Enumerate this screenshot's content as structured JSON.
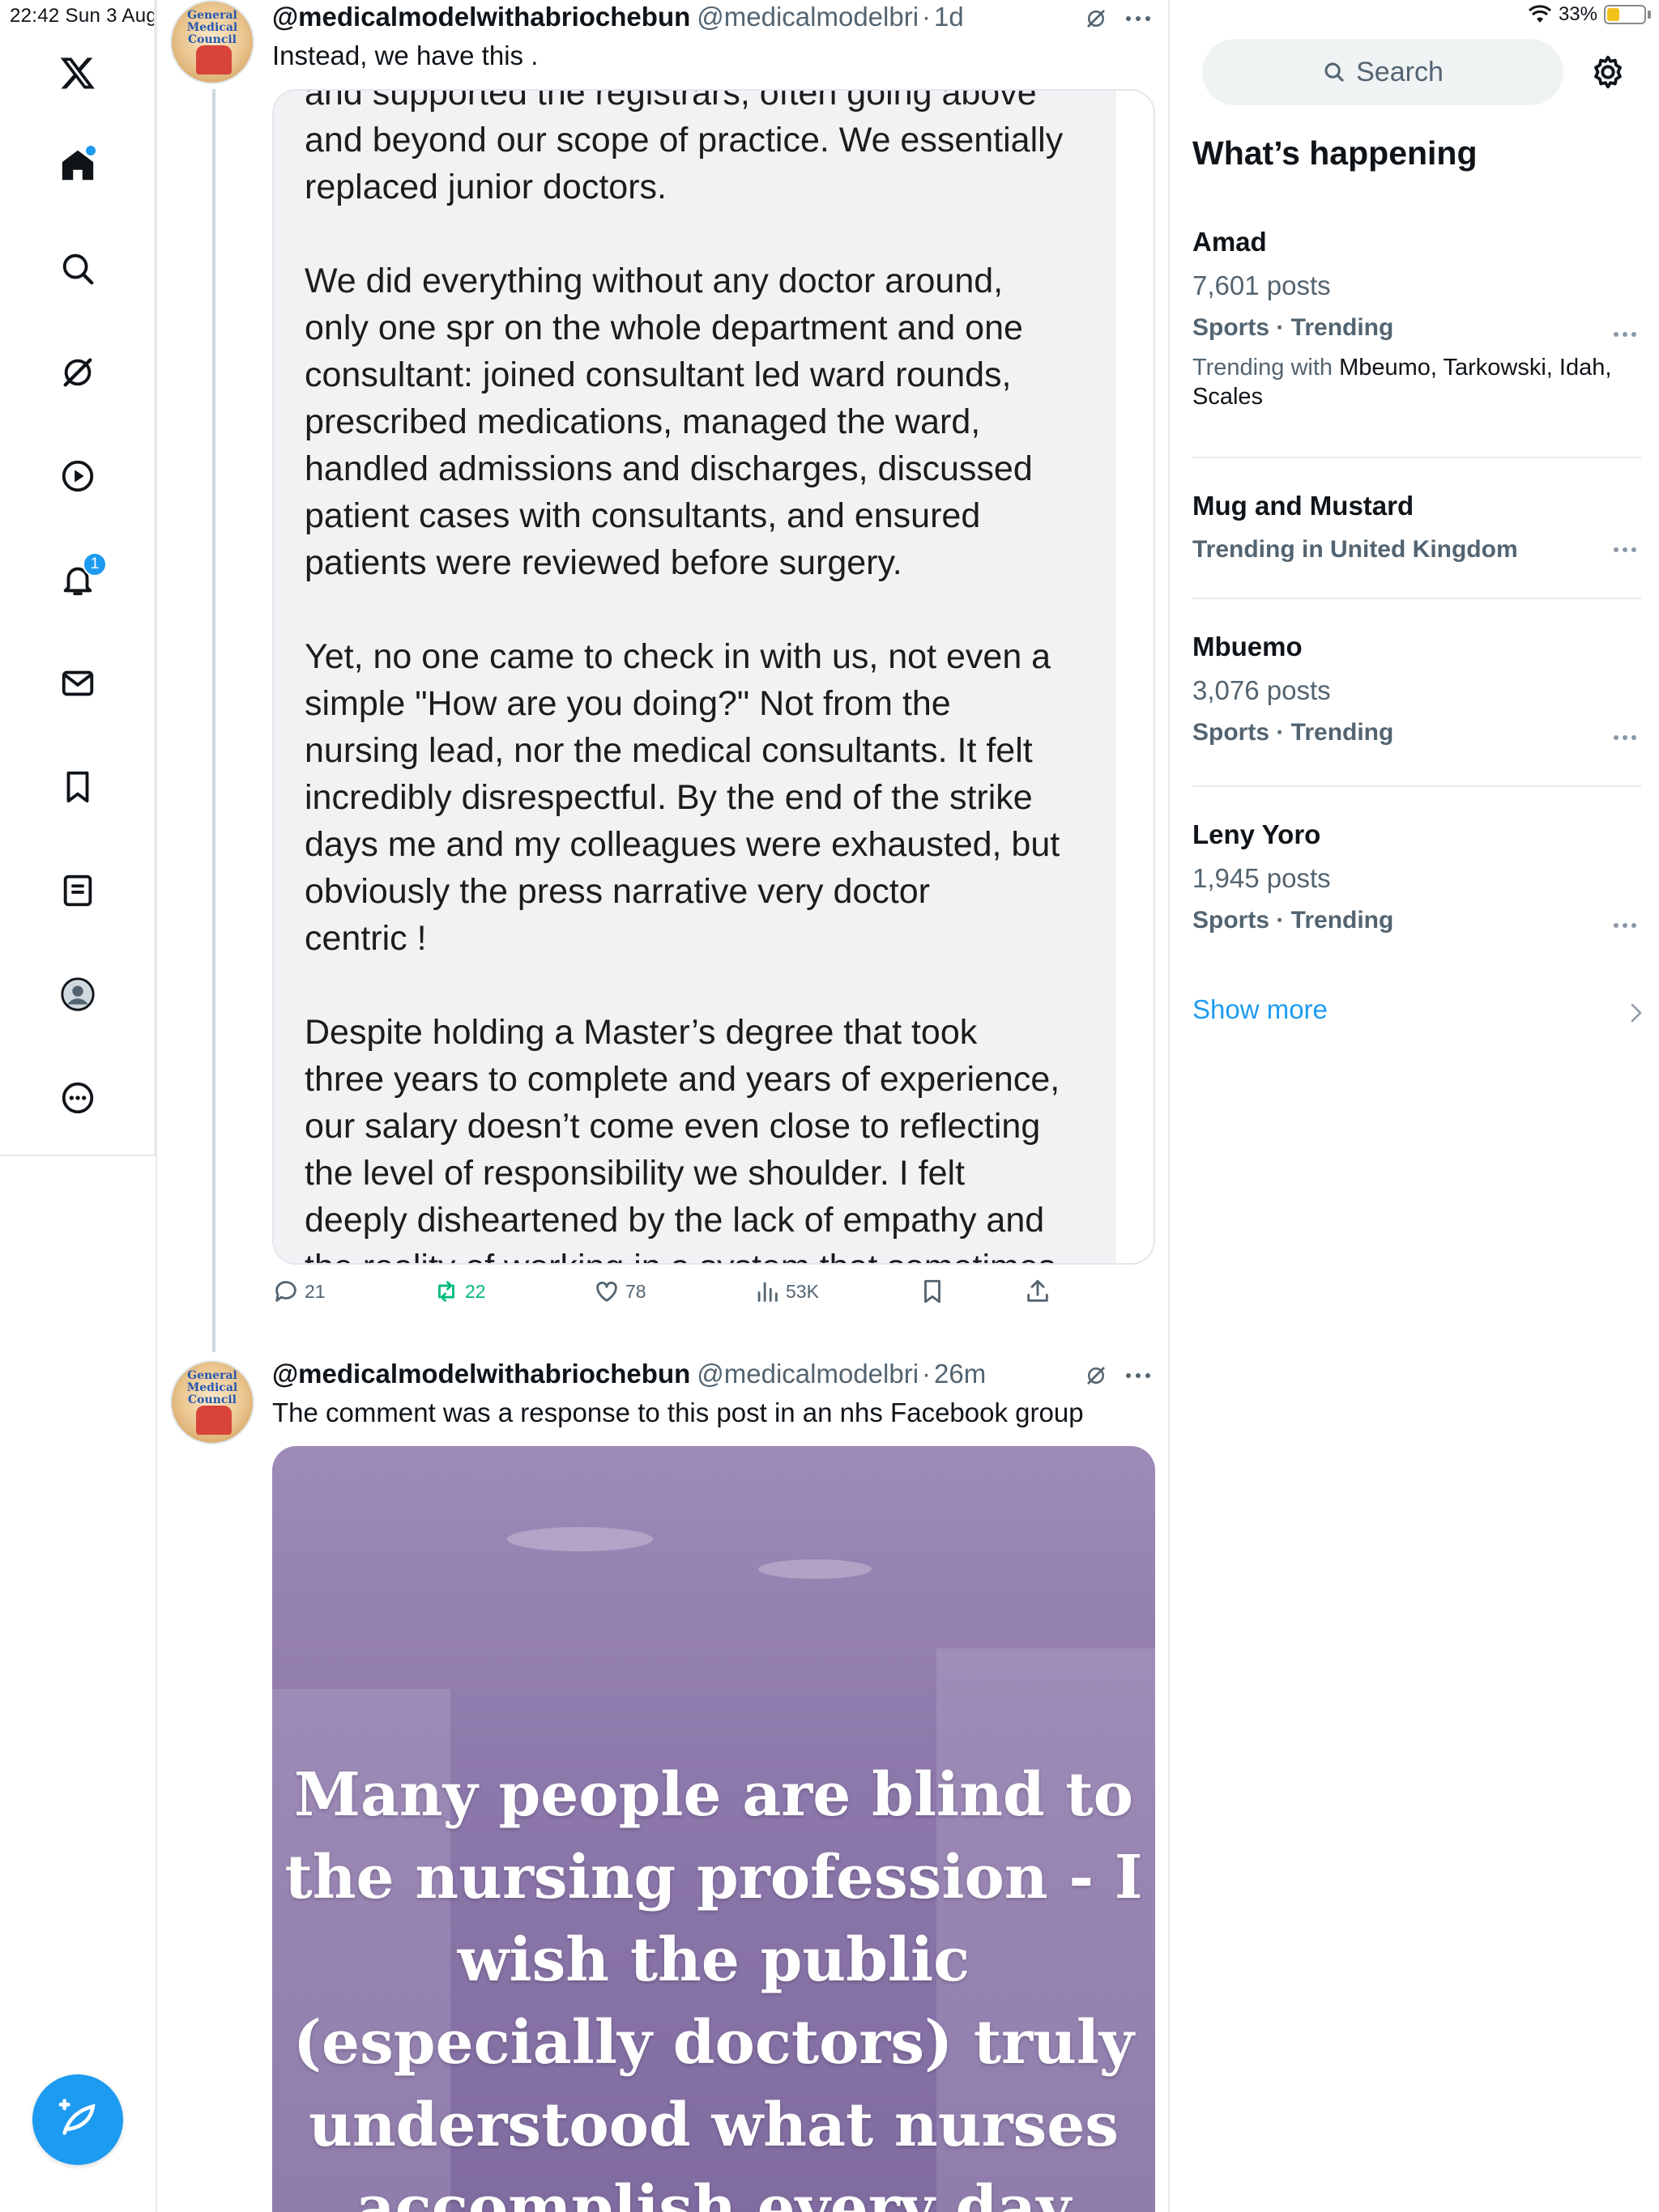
{
  "status_bar": {
    "time_date": "22:42  Sun 3 Aug",
    "battery": "33%",
    "battery_level": 0.33
  },
  "nav": {
    "items": [
      "x-logo",
      "home",
      "explore",
      "grok",
      "video",
      "notifications",
      "messages",
      "bookmarks",
      "lists",
      "profile",
      "more"
    ],
    "notification_count": "1"
  },
  "tweets": [
    {
      "name": "@medicalmodelwithabriochebun",
      "handle": "@medicalmodelbri",
      "time": "1d",
      "text": "Instead, we have this .",
      "image_text": "and supported the registrars, often going above\nand beyond our scope of practice. We essentially\nreplaced junior doctors.\n\nWe did everything without any doctor around,\nonly one spr on the whole department and one\nconsultant: joined consultant led ward rounds,\nprescribed medications, managed the ward,\nhandled admissions and discharges, discussed\npatient cases with consultants, and ensured\npatients were reviewed before surgery.\n\nYet, no one came to check in with us, not even a\nsimple \"How are you doing?\" Not from the\nnursing lead, nor the medical consultants. It felt\nincredibly disrespectful. By the end of the strike\ndays me and my colleagues were exhausted, but\nobviously the press narrative very doctor\ncentric !\n\nDespite holding a Master’s degree that took\nthree years to complete and years of experience,\nour salary doesn’t come even close to reflecting\nthe level of responsibility we shoulder. I felt\ndeeply disheartened by the lack of empathy and\nthe reality of working in a system that sometimes",
      "replies": "21",
      "reposts": "22",
      "likes": "78",
      "views": "53K"
    },
    {
      "name": "@medicalmodelwithabriochebun",
      "handle": "@medicalmodelbri",
      "time": "26m",
      "text": "The comment was a response to this post in an nhs Facebook group",
      "image_text": "Many people are blind to\nthe nursing profession - I\nwish the public\n(especially doctors) truly\nunderstood what nurses\naccomplish every day"
    }
  ],
  "sidebar": {
    "search_placeholder": "Search",
    "title": "What’s happening",
    "trends": [
      {
        "name": "Amad",
        "posts": "7,601 posts",
        "meta": "Sports · Trending",
        "with_prefix": "Trending with",
        "with_names": "Mbeumo, Tarkowski, Idah, Scales"
      },
      {
        "name": "Mug and Mustard",
        "meta": "Trending in United Kingdom"
      },
      {
        "name": "Mbuemo",
        "posts": "3,076 posts",
        "meta": "Sports · Trending"
      },
      {
        "name": "Leny Yoro",
        "posts": "1,945 posts",
        "meta": "Sports · Trending"
      }
    ],
    "show_more": "Show more"
  },
  "avatar_text": "General\nMedical\nCouncil",
  "colors": {
    "accent": "#1d9bf0",
    "repost": "#00ba7c",
    "muted": "#536471"
  }
}
